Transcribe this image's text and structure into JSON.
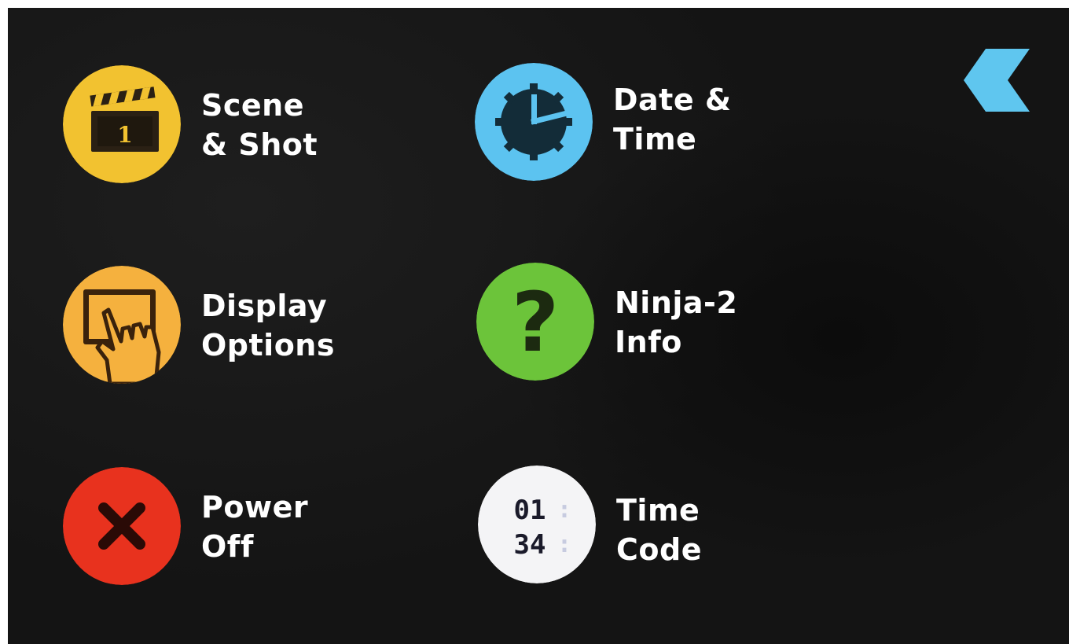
{
  "menu": {
    "scene_shot": {
      "line1": "Scene",
      "line2": "& Shot",
      "icon": "clapperboard-icon",
      "clapper_number": "1",
      "color": "#f2c230"
    },
    "date_time": {
      "line1": "Date &",
      "line2": "Time",
      "icon": "clock-icon",
      "color": "#5cc3f0"
    },
    "display_options": {
      "line1": "Display",
      "line2": "Options",
      "icon": "touch-hand-icon",
      "color": "#f5b13e"
    },
    "ninja_info": {
      "line1": "Ninja-2",
      "line2": "Info",
      "icon": "question-mark-icon",
      "glyph": "?",
      "color": "#6cc43a"
    },
    "power_off": {
      "line1": "Power",
      "line2": "Off",
      "icon": "close-x-icon",
      "color": "#e8321e"
    },
    "time_code": {
      "line1": "Time",
      "line2": "Code",
      "icon": "timecode-icon",
      "tc_top": "01",
      "tc_bottom": "34",
      "tc_separator": ":",
      "color": "#f4f4f6"
    }
  },
  "back_button": {
    "icon": "chevron-left-icon",
    "color": "#5fc6ef"
  }
}
